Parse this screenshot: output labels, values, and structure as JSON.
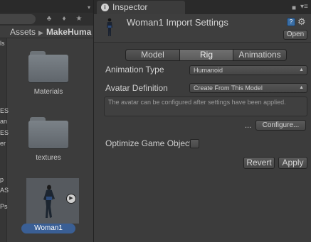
{
  "project": {
    "breadcrumb": [
      "Assets",
      "MakeHuma"
    ],
    "tree_fragments": [
      "ls",
      "ES",
      "an",
      "ES",
      "er",
      "p",
      "AS",
      "Ps"
    ],
    "assets": [
      {
        "label": "Materials",
        "icon": "folder-icon"
      },
      {
        "label": "textures",
        "icon": "folder-icon"
      },
      {
        "label": "Woman1",
        "icon": "model-thumbnail",
        "selected": true
      }
    ]
  },
  "inspector": {
    "tab_title": "Inspector",
    "tab_icon": "info-icon",
    "asset_title": "Woman1 Import Settings",
    "open_label": "Open",
    "tabs": [
      {
        "label": "Model",
        "active": false
      },
      {
        "label": "Rig",
        "active": true
      },
      {
        "label": "Animations",
        "active": false
      }
    ],
    "animation_type": {
      "label": "Animation Type",
      "value": "Humanoid"
    },
    "avatar_definition": {
      "label": "Avatar Definition",
      "value": "Create From This Model"
    },
    "info_text": "The avatar can be configured after settings have been applied.",
    "ellipsis": "...",
    "configure_label": "Configure...",
    "optimize_label": "Optimize Game Object",
    "optimize_checked": false,
    "revert_label": "Revert",
    "apply_label": "Apply"
  },
  "colors": {
    "selection": "#3a5f95",
    "panel_bg": "#3c3c3c",
    "topbar_bg": "#2a2a2a"
  }
}
